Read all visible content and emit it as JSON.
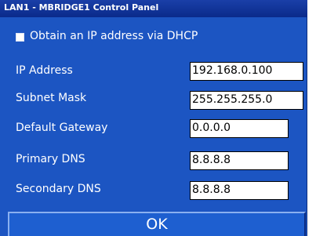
{
  "window": {
    "title": "LAN1 - MBRIDGE1  Control Panel"
  },
  "dhcp": {
    "label": "Obtain an IP address via DHCP",
    "checked": false
  },
  "fields": [
    {
      "label": "IP Address",
      "value": "192.168.0.100"
    },
    {
      "label": "Subnet Mask",
      "value": "255.255.255.0"
    },
    {
      "label": "Default Gateway",
      "value": "0.0.0.0"
    },
    {
      "label": "Primary DNS",
      "value": "8.8.8.8"
    },
    {
      "label": "Secondary DNS",
      "value": "8.8.8.8"
    }
  ],
  "ok_button": {
    "label": "OK"
  },
  "colors": {
    "panel_background": "#1c55c2",
    "titlebar": "#0a2a8a",
    "text": "#ffffff"
  }
}
